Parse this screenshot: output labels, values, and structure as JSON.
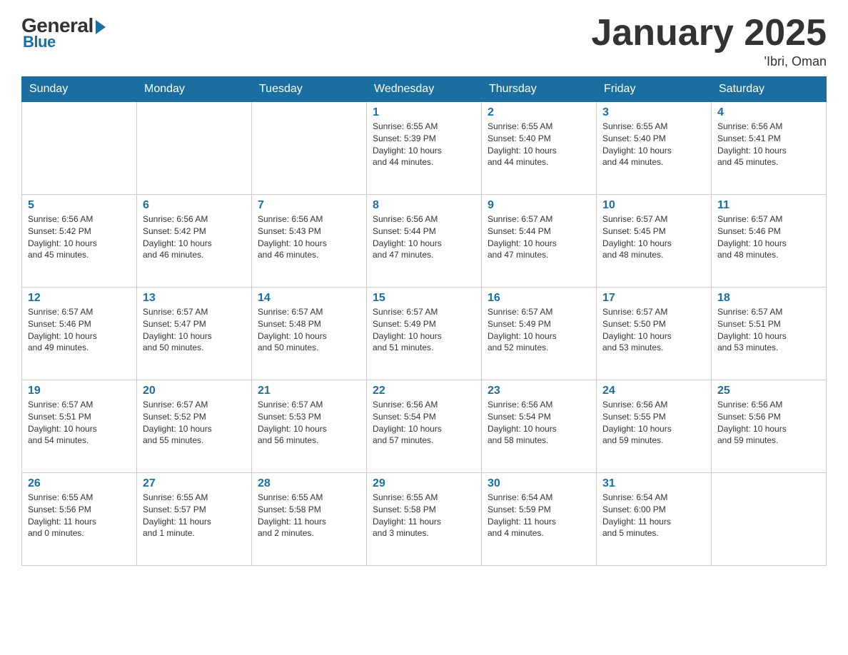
{
  "header": {
    "logo": {
      "general": "General",
      "blue": "Blue",
      "underline": "Blue"
    },
    "title": "January 2025",
    "location": "'Ibri, Oman"
  },
  "calendar": {
    "days_of_week": [
      "Sunday",
      "Monday",
      "Tuesday",
      "Wednesday",
      "Thursday",
      "Friday",
      "Saturday"
    ],
    "weeks": [
      [
        {
          "day": "",
          "info": ""
        },
        {
          "day": "",
          "info": ""
        },
        {
          "day": "",
          "info": ""
        },
        {
          "day": "1",
          "info": "Sunrise: 6:55 AM\nSunset: 5:39 PM\nDaylight: 10 hours\nand 44 minutes."
        },
        {
          "day": "2",
          "info": "Sunrise: 6:55 AM\nSunset: 5:40 PM\nDaylight: 10 hours\nand 44 minutes."
        },
        {
          "day": "3",
          "info": "Sunrise: 6:55 AM\nSunset: 5:40 PM\nDaylight: 10 hours\nand 44 minutes."
        },
        {
          "day": "4",
          "info": "Sunrise: 6:56 AM\nSunset: 5:41 PM\nDaylight: 10 hours\nand 45 minutes."
        }
      ],
      [
        {
          "day": "5",
          "info": "Sunrise: 6:56 AM\nSunset: 5:42 PM\nDaylight: 10 hours\nand 45 minutes."
        },
        {
          "day": "6",
          "info": "Sunrise: 6:56 AM\nSunset: 5:42 PM\nDaylight: 10 hours\nand 46 minutes."
        },
        {
          "day": "7",
          "info": "Sunrise: 6:56 AM\nSunset: 5:43 PM\nDaylight: 10 hours\nand 46 minutes."
        },
        {
          "day": "8",
          "info": "Sunrise: 6:56 AM\nSunset: 5:44 PM\nDaylight: 10 hours\nand 47 minutes."
        },
        {
          "day": "9",
          "info": "Sunrise: 6:57 AM\nSunset: 5:44 PM\nDaylight: 10 hours\nand 47 minutes."
        },
        {
          "day": "10",
          "info": "Sunrise: 6:57 AM\nSunset: 5:45 PM\nDaylight: 10 hours\nand 48 minutes."
        },
        {
          "day": "11",
          "info": "Sunrise: 6:57 AM\nSunset: 5:46 PM\nDaylight: 10 hours\nand 48 minutes."
        }
      ],
      [
        {
          "day": "12",
          "info": "Sunrise: 6:57 AM\nSunset: 5:46 PM\nDaylight: 10 hours\nand 49 minutes."
        },
        {
          "day": "13",
          "info": "Sunrise: 6:57 AM\nSunset: 5:47 PM\nDaylight: 10 hours\nand 50 minutes."
        },
        {
          "day": "14",
          "info": "Sunrise: 6:57 AM\nSunset: 5:48 PM\nDaylight: 10 hours\nand 50 minutes."
        },
        {
          "day": "15",
          "info": "Sunrise: 6:57 AM\nSunset: 5:49 PM\nDaylight: 10 hours\nand 51 minutes."
        },
        {
          "day": "16",
          "info": "Sunrise: 6:57 AM\nSunset: 5:49 PM\nDaylight: 10 hours\nand 52 minutes."
        },
        {
          "day": "17",
          "info": "Sunrise: 6:57 AM\nSunset: 5:50 PM\nDaylight: 10 hours\nand 53 minutes."
        },
        {
          "day": "18",
          "info": "Sunrise: 6:57 AM\nSunset: 5:51 PM\nDaylight: 10 hours\nand 53 minutes."
        }
      ],
      [
        {
          "day": "19",
          "info": "Sunrise: 6:57 AM\nSunset: 5:51 PM\nDaylight: 10 hours\nand 54 minutes."
        },
        {
          "day": "20",
          "info": "Sunrise: 6:57 AM\nSunset: 5:52 PM\nDaylight: 10 hours\nand 55 minutes."
        },
        {
          "day": "21",
          "info": "Sunrise: 6:57 AM\nSunset: 5:53 PM\nDaylight: 10 hours\nand 56 minutes."
        },
        {
          "day": "22",
          "info": "Sunrise: 6:56 AM\nSunset: 5:54 PM\nDaylight: 10 hours\nand 57 minutes."
        },
        {
          "day": "23",
          "info": "Sunrise: 6:56 AM\nSunset: 5:54 PM\nDaylight: 10 hours\nand 58 minutes."
        },
        {
          "day": "24",
          "info": "Sunrise: 6:56 AM\nSunset: 5:55 PM\nDaylight: 10 hours\nand 59 minutes."
        },
        {
          "day": "25",
          "info": "Sunrise: 6:56 AM\nSunset: 5:56 PM\nDaylight: 10 hours\nand 59 minutes."
        }
      ],
      [
        {
          "day": "26",
          "info": "Sunrise: 6:55 AM\nSunset: 5:56 PM\nDaylight: 11 hours\nand 0 minutes."
        },
        {
          "day": "27",
          "info": "Sunrise: 6:55 AM\nSunset: 5:57 PM\nDaylight: 11 hours\nand 1 minute."
        },
        {
          "day": "28",
          "info": "Sunrise: 6:55 AM\nSunset: 5:58 PM\nDaylight: 11 hours\nand 2 minutes."
        },
        {
          "day": "29",
          "info": "Sunrise: 6:55 AM\nSunset: 5:58 PM\nDaylight: 11 hours\nand 3 minutes."
        },
        {
          "day": "30",
          "info": "Sunrise: 6:54 AM\nSunset: 5:59 PM\nDaylight: 11 hours\nand 4 minutes."
        },
        {
          "day": "31",
          "info": "Sunrise: 6:54 AM\nSunset: 6:00 PM\nDaylight: 11 hours\nand 5 minutes."
        },
        {
          "day": "",
          "info": ""
        }
      ]
    ]
  }
}
